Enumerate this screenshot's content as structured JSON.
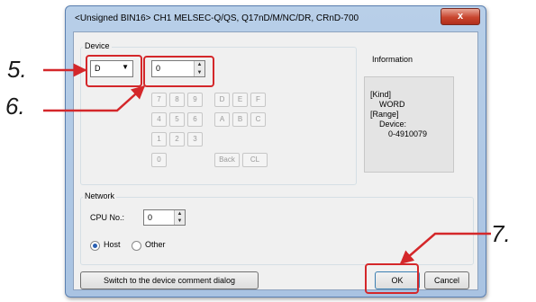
{
  "window": {
    "title": "<Unsigned BIN16> CH1 MELSEC-Q/QS, Q17nD/M/NC/DR, CRnD-700",
    "close_symbol": "x"
  },
  "device_group": {
    "label": "Device",
    "device_type": "D",
    "device_number": "0",
    "keypad": {
      "digits": [
        "7",
        "8",
        "9",
        "4",
        "5",
        "6",
        "1",
        "2",
        "3",
        "0"
      ],
      "letters": [
        "D",
        "E",
        "F",
        "A",
        "B",
        "C"
      ],
      "back": "Back",
      "clear": "CL"
    }
  },
  "information": {
    "label": "Information",
    "kind_label": "[Kind]",
    "kind_value": "WORD",
    "range_label": "[Range]",
    "range_device_label": "Device:",
    "range_device_value": "0-4910079"
  },
  "network_group": {
    "label": "Network",
    "cpu_label": "CPU No.:",
    "cpu_value": "0",
    "host_label": "Host",
    "other_label": "Other",
    "selected": "Host"
  },
  "buttons": {
    "switch_comment": "Switch to the device comment dialog",
    "ok": "OK",
    "cancel": "Cancel"
  },
  "callouts": {
    "step5": "5.",
    "step6": "6.",
    "step7": "7."
  },
  "colors": {
    "highlight": "#d4272a",
    "titlebar": "#b8cfe8"
  }
}
